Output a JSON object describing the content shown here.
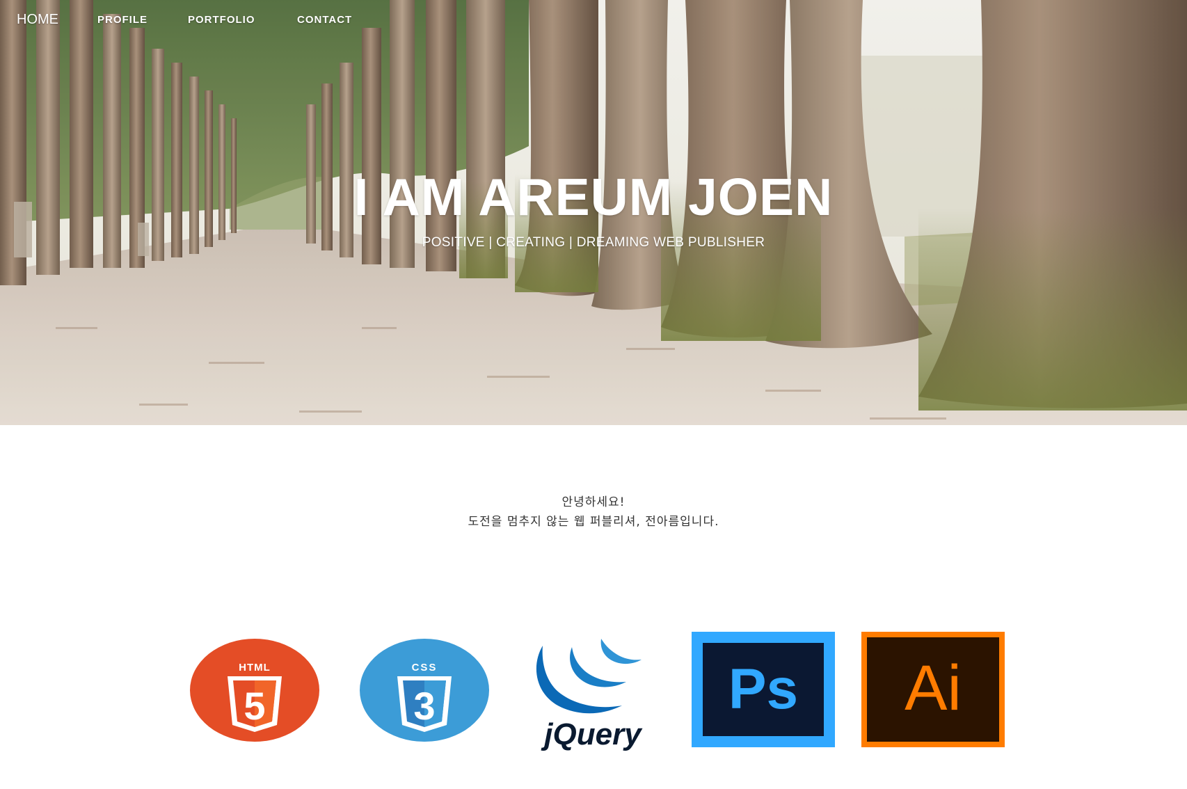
{
  "nav": {
    "items": [
      {
        "label": "HOME"
      },
      {
        "label": "PROFILE"
      },
      {
        "label": "PORTFOLIO"
      },
      {
        "label": "CONTACT"
      }
    ]
  },
  "hero": {
    "title": "I AM AREUM JOEN",
    "subtitle": "POSITIVE | CREATING | DREAMING WEB PUBLISHER",
    "background_image": "tree-lined forest path"
  },
  "intro": {
    "line1": "안녕하세요!",
    "line2": "도전을 멈추지 않는 웹 퍼블리셔, 전아름입니다."
  },
  "skills": {
    "items": [
      {
        "name": "HTML",
        "icon": "html5-icon",
        "badge_text": "HTML",
        "glyph": "5",
        "color": "#e44d26"
      },
      {
        "name": "CSS",
        "icon": "css3-icon",
        "badge_text": "CSS",
        "glyph": "3",
        "color": "#3c9cd7"
      },
      {
        "name": "jQuery",
        "icon": "jquery-icon",
        "logo_text": "jQuery",
        "color": "#0b69b6"
      },
      {
        "name": "Photoshop",
        "icon": "photoshop-icon",
        "logo_text": "Ps",
        "color": "#31a8ff",
        "bg": "#0b1832"
      },
      {
        "name": "Illustrator",
        "icon": "illustrator-icon",
        "logo_text": "Ai",
        "color": "#ff7c00",
        "bg": "#2b1300"
      }
    ]
  }
}
